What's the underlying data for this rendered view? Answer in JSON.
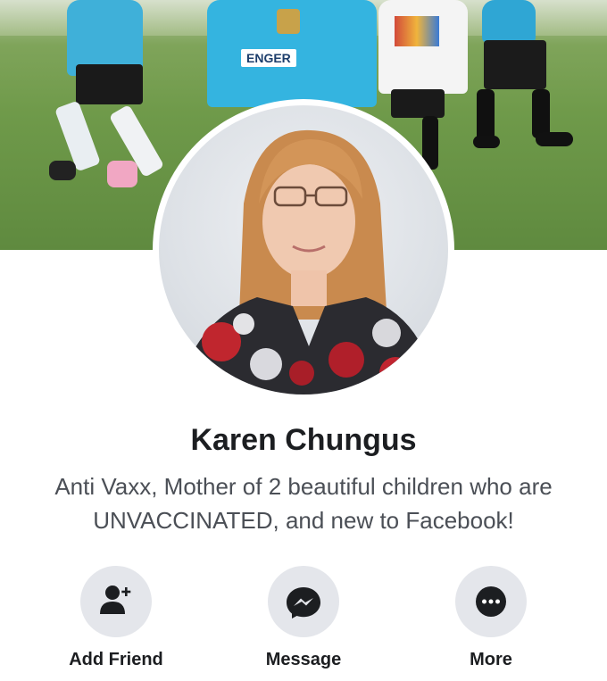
{
  "profile": {
    "name": "Karen Chungus",
    "bio": "Anti Vaxx, Mother of 2 beautiful children who are UNVACCINATED, and new to Facebook!"
  },
  "cover": {
    "jersey_text": "ENGER"
  },
  "actions": [
    {
      "label": "Add Friend",
      "icon": "add-friend-icon"
    },
    {
      "label": "Message",
      "icon": "messenger-icon"
    },
    {
      "label": "More",
      "icon": "more-icon"
    }
  ],
  "colors": {
    "action_bg": "#e4e6eb",
    "icon": "#1c1e21",
    "name": "#1c1e21",
    "bio": "#4b4f56"
  }
}
